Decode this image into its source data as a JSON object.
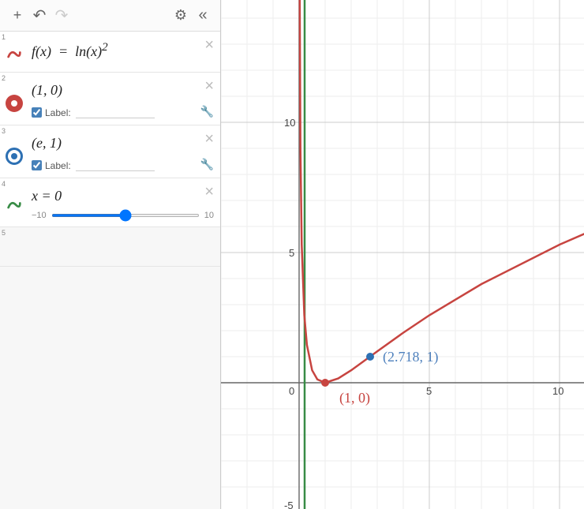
{
  "toolbar": {
    "add": "+",
    "undo": "↶",
    "redo": "↷",
    "settings": "⚙",
    "collapse": "«"
  },
  "expressions": [
    {
      "idx": "1",
      "math_html": "<i>f</i>(<i>x</i>) &nbsp;=&nbsp; ln(<i>x</i>)<sup>2</sup>",
      "icon": "swirl-red",
      "color": "#c74440"
    },
    {
      "idx": "2",
      "math_html": "(1, 0)",
      "icon": "dot-red",
      "color": "#c74440",
      "has_label": true,
      "label_text": "Label:"
    },
    {
      "idx": "3",
      "math_html": "(<i>e</i>, 1)",
      "icon": "dot-blue",
      "color": "#2d70b3",
      "has_label": true,
      "label_text": "Label:"
    },
    {
      "idx": "4",
      "math_html": "<i>x</i> = 0",
      "icon": "swirl-green",
      "color": "#388c46",
      "slider": {
        "min": "−10",
        "max": "10",
        "value": 0
      }
    },
    {
      "idx": "5",
      "empty": true
    }
  ],
  "graph": {
    "x_ticks": [
      "0",
      "5",
      "10"
    ],
    "y_ticks": [
      "-5",
      "5",
      "10"
    ],
    "point1_label": "(1, 0)",
    "point2_label": "(2.718, 1)"
  },
  "chart_data": {
    "type": "line",
    "title": "",
    "xlabel": "",
    "ylabel": "",
    "xlim": [
      -2,
      12
    ],
    "ylim": [
      -6,
      14
    ],
    "series": [
      {
        "name": "f(x)=ln(x)^2",
        "color": "#c74440",
        "x": [
          0.02,
          0.05,
          0.1,
          0.2,
          0.3,
          0.5,
          0.7,
          1,
          1.5,
          2,
          2.718,
          3,
          4,
          5,
          7,
          10,
          12
        ],
        "y": [
          15.3,
          8.97,
          5.3,
          2.59,
          1.45,
          0.48,
          0.127,
          0,
          0.164,
          0.48,
          1.0,
          1.207,
          1.922,
          2.59,
          3.787,
          5.302,
          6.174
        ]
      },
      {
        "name": "x=0",
        "color": "#388c46",
        "type": "vline",
        "x": 0
      }
    ],
    "points": [
      {
        "name": "(1,0)",
        "x": 1,
        "y": 0,
        "color": "#c74440",
        "label": "(1, 0)"
      },
      {
        "name": "(e,1)",
        "x": 2.718,
        "y": 1,
        "color": "#2d70b3",
        "label": "(2.718, 1)"
      }
    ]
  }
}
